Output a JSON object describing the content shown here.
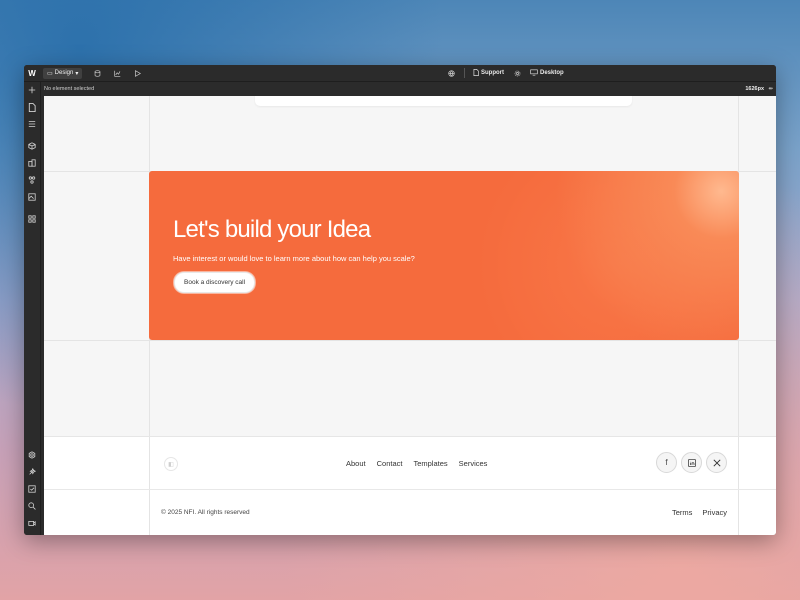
{
  "toolbar": {
    "mode_label": "Design",
    "support_label": "Support",
    "device_label": "Desktop"
  },
  "subbar": {
    "selection_text": "No element selected",
    "width_readout": "1626px"
  },
  "cta": {
    "title": "Let's build your Idea",
    "subtitle": "Have interest or would love to learn more about how can help you scale?",
    "button_label": "Book a discovery call",
    "accent": "#f56b3d"
  },
  "footer": {
    "nav": [
      "About",
      "Contact",
      "Templates",
      "Services"
    ],
    "social_icons": [
      "facebook-icon",
      "linkedin-icon",
      "x-icon"
    ],
    "copyright": "© 2025 NFI. All rights reserved",
    "legal": [
      "Terms",
      "Privacy"
    ]
  },
  "colors": {
    "editor_bg": "#2b2b2b",
    "canvas_bg": "#f6f6f6"
  }
}
